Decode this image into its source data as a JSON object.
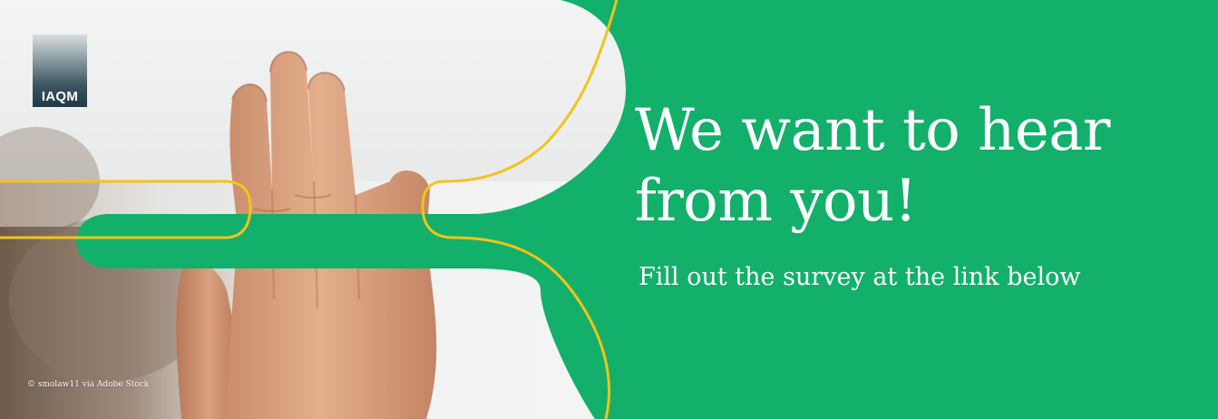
{
  "logo": {
    "text": "IAQM"
  },
  "headline": {
    "line1": "We want to hear",
    "line2": "from you!"
  },
  "subline": "Fill out the survey at the link below",
  "credit": "© smolaw11 via Adobe Stock",
  "colors": {
    "green": "#12b06a",
    "yellow_line": "#f5c318",
    "text": "#ffffff"
  },
  "icons": [
    "iaqm-logo",
    "hand-photo"
  ]
}
